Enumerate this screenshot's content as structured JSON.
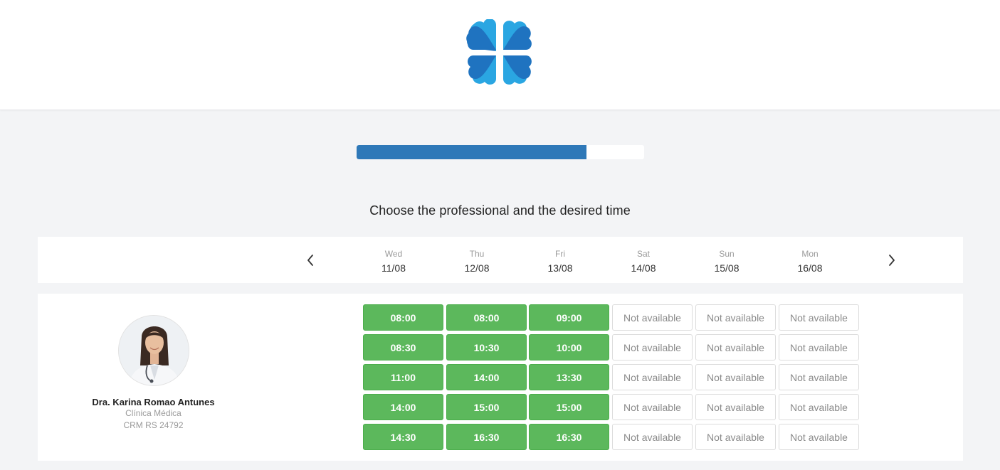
{
  "progress": {
    "fraction": 0.8
  },
  "title": "Choose the professional and the desired time",
  "colors": {
    "accent": "#2e78b8",
    "available": "#5cb85c",
    "logo_dark": "#1f73c0",
    "logo_light": "#2aa6e2"
  },
  "nav": {
    "prev_icon": "chevron-left-icon",
    "next_icon": "chevron-right-icon"
  },
  "days": [
    {
      "name": "Wed",
      "date": "11/08"
    },
    {
      "name": "Thu",
      "date": "12/08"
    },
    {
      "name": "Fri",
      "date": "13/08"
    },
    {
      "name": "Sat",
      "date": "14/08"
    },
    {
      "name": "Sun",
      "date": "15/08"
    },
    {
      "name": "Mon",
      "date": "16/08"
    }
  ],
  "professional": {
    "name": "Dra. Karina Romao Antunes",
    "specialty": "Clínica Médica",
    "crm": "CRM RS 24792"
  },
  "schedule": [
    [
      "08:00",
      "08:30",
      "11:00",
      "14:00",
      "14:30"
    ],
    [
      "08:00",
      "10:30",
      "14:00",
      "15:00",
      "16:30"
    ],
    [
      "09:00",
      "10:00",
      "13:30",
      "15:00",
      "16:30"
    ],
    [
      "Not available",
      "Not available",
      "Not available",
      "Not available",
      "Not available"
    ],
    [
      "Not available",
      "Not available",
      "Not available",
      "Not available",
      "Not available"
    ],
    [
      "Not available",
      "Not available",
      "Not available",
      "Not available",
      "Not available"
    ]
  ]
}
